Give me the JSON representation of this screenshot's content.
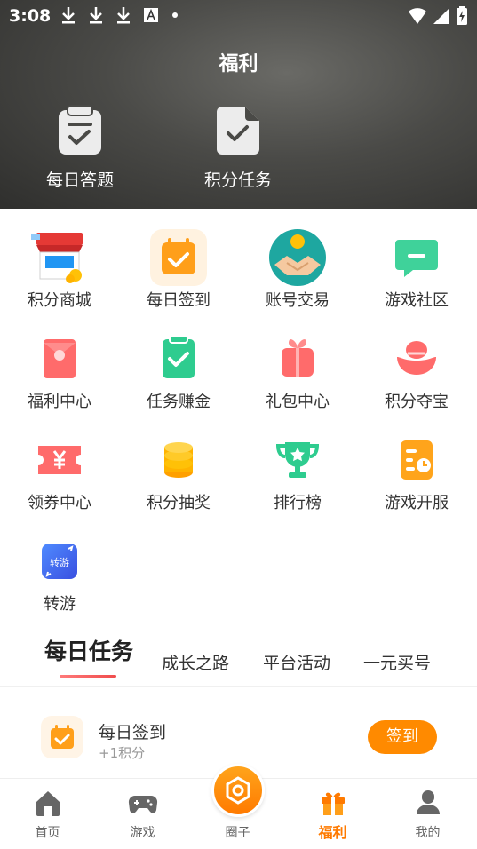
{
  "status_bar": {
    "time": "3:08"
  },
  "header": {
    "title": "福利",
    "quick_actions": [
      {
        "label": "每日答题",
        "icon": "clipboard-check-icon"
      },
      {
        "label": "积分任务",
        "icon": "document-check-icon"
      }
    ]
  },
  "grid": {
    "items": [
      {
        "label": "积分商城",
        "icon": "points-mall-icon"
      },
      {
        "label": "每日签到",
        "icon": "calendar-check-icon"
      },
      {
        "label": "账号交易",
        "icon": "handshake-coin-icon"
      },
      {
        "label": "游戏社区",
        "icon": "chat-bubble-icon"
      },
      {
        "label": "福利中心",
        "icon": "red-envelope-icon"
      },
      {
        "label": "任务赚金",
        "icon": "task-check-icon"
      },
      {
        "label": "礼包中心",
        "icon": "gift-box-icon"
      },
      {
        "label": "积分夺宝",
        "icon": "treasure-ingot-icon"
      },
      {
        "label": "领券中心",
        "icon": "coupon-icon"
      },
      {
        "label": "积分抽奖",
        "icon": "coin-stack-icon"
      },
      {
        "label": "排行榜",
        "icon": "trophy-icon"
      },
      {
        "label": "游戏开服",
        "icon": "server-clock-icon"
      },
      {
        "label": "转游",
        "icon": "transfer-game-icon",
        "badge": "转游"
      }
    ],
    "mall_sign": "积分商城"
  },
  "tabs": [
    {
      "label": "每日任务",
      "active": true
    },
    {
      "label": "成长之路",
      "active": false
    },
    {
      "label": "平台活动",
      "active": false
    },
    {
      "label": "一元买号",
      "active": false
    }
  ],
  "task": {
    "title": "每日签到",
    "reward": "+1积分",
    "button": "签到"
  },
  "bottom_nav": [
    {
      "label": "首页",
      "icon": "home-icon",
      "active": false
    },
    {
      "label": "游戏",
      "icon": "gamepad-icon",
      "active": false
    },
    {
      "label": "圈子",
      "icon": "hexagon-icon",
      "active": false
    },
    {
      "label": "福利",
      "icon": "gift-icon",
      "active": true
    },
    {
      "label": "我的",
      "icon": "user-icon",
      "active": false
    }
  ],
  "colors": {
    "accent": "#ff7a00",
    "button": "#ff8a00",
    "tab_underline": "#f04c4c",
    "header_bg": "#4a4a47"
  }
}
